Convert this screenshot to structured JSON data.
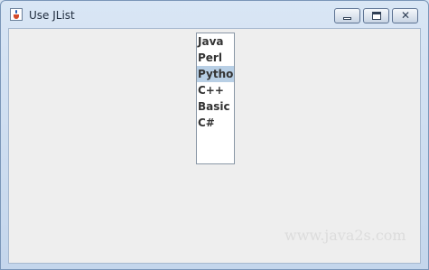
{
  "window": {
    "title": "Use JList",
    "icon": "java-cup-icon"
  },
  "title_buttons": {
    "minimize_icon": "minimize-icon",
    "maximize_icon": "maximize-icon",
    "close_icon": "close-icon",
    "close_glyph": "✕"
  },
  "list": {
    "items": [
      {
        "label": "Java",
        "selected": false
      },
      {
        "label": "Perl",
        "selected": false
      },
      {
        "label": "Python",
        "selected": true
      },
      {
        "label": "C++",
        "selected": false
      },
      {
        "label": "Basic",
        "selected": false
      },
      {
        "label": "C#",
        "selected": false
      }
    ],
    "selected_color": "#b8cfe5"
  },
  "watermark": "www.java2s.com"
}
